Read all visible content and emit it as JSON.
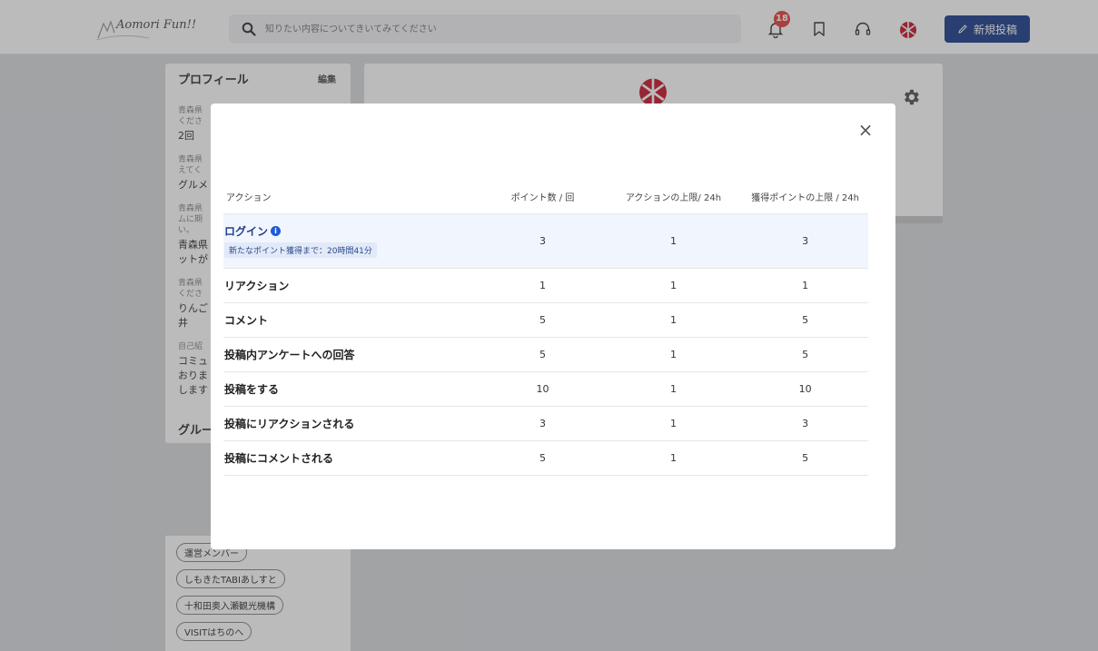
{
  "header": {
    "logo_text": "Aomori Fun!!",
    "search_placeholder": "知りたい内容についてきいてみてください",
    "notification_count": "18",
    "new_post_label": "新規投稿"
  },
  "sidebar": {
    "profile_title": "プロフィール",
    "edit_label": "編集",
    "fields": [
      {
        "q": "青森県\nくださ",
        "a": "2回"
      },
      {
        "q": "青森県\nえてく",
        "a": "グルメ"
      },
      {
        "q": "青森県\nムに期\nい。",
        "a": "青森県\nットが"
      },
      {
        "q": "青森県\nくださ",
        "a": "りんご\n井"
      },
      {
        "q": "自己紹",
        "a": "コミュ\nおりま\nします"
      }
    ],
    "groups_title": "グルー",
    "tags": [
      "運営メンバー",
      "しもきたTABIあしすと",
      "十和田奥入瀬観光機構",
      "VISITはちのへ"
    ]
  },
  "modal": {
    "columns": [
      "アクション",
      "ポイント数 / 回",
      "アクションの上限/ 24h",
      "獲得ポイントの上限 / 24h"
    ],
    "rows": [
      {
        "action": "ログイン",
        "points": "3",
        "limit": "1",
        "max": "3",
        "note": "新たなポイント獲得まで：20時間41分"
      },
      {
        "action": "リアクション",
        "points": "1",
        "limit": "1",
        "max": "1"
      },
      {
        "action": "コメント",
        "points": "5",
        "limit": "1",
        "max": "5"
      },
      {
        "action": "投稿内アンケートへの回答",
        "points": "5",
        "limit": "1",
        "max": "5"
      },
      {
        "action": "投稿をする",
        "points": "10",
        "limit": "1",
        "max": "10"
      },
      {
        "action": "投稿にリアクションされる",
        "points": "3",
        "limit": "1",
        "max": "3"
      },
      {
        "action": "投稿にコメントされる",
        "points": "5",
        "limit": "1",
        "max": "5"
      }
    ],
    "close_glyph": "×",
    "info_glyph": "i"
  },
  "colors": {
    "brand": "#1f3f8c",
    "badge": "#e8413b",
    "highlight_row": "#f1f5fd"
  }
}
